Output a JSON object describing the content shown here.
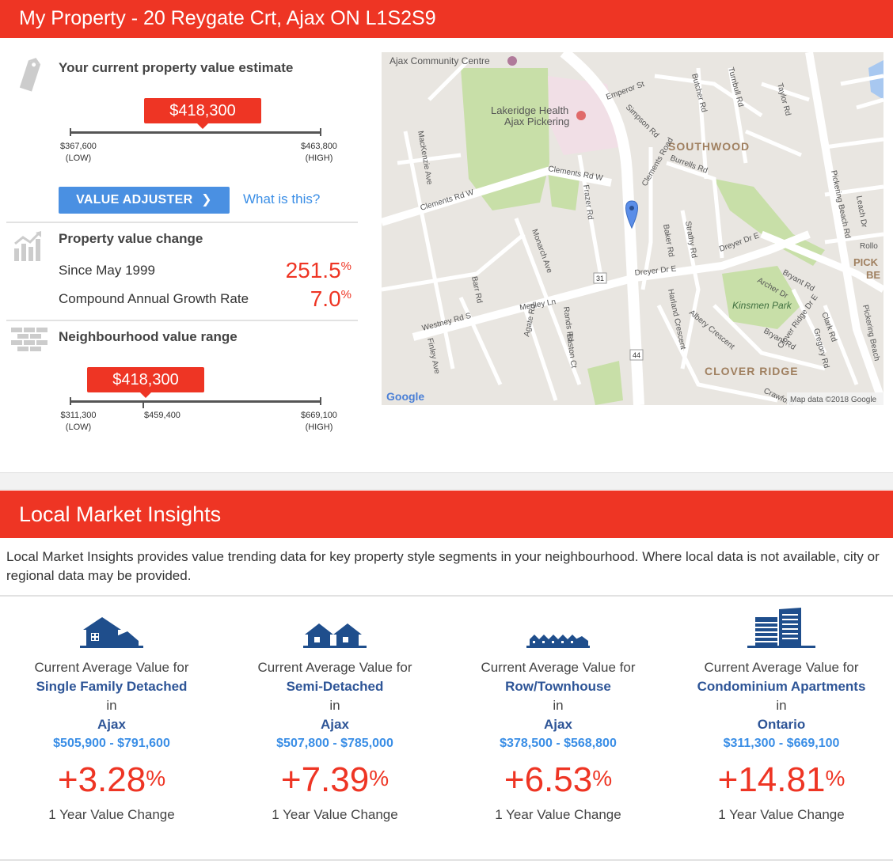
{
  "property": {
    "title": "My Property - 20 Reygate Crt, Ajax ON L1S2S9",
    "estimate": {
      "heading": "Your current property value estimate",
      "value": "$418,300",
      "low": "$367,600",
      "low_label": "(LOW)",
      "high": "$463,800",
      "high_label": "(HIGH)",
      "position_fraction": 0.532
    },
    "adjuster_button": "VALUE ADJUSTER",
    "what_link": "What is this?",
    "change": {
      "heading": "Property value change",
      "rows": [
        {
          "label": "Since May 1999",
          "value": "251.5",
          "unit": "%"
        },
        {
          "label": "Compound Annual Growth Rate",
          "value": "7.0",
          "unit": "%"
        }
      ]
    },
    "neighbourhood": {
      "heading": "Neighbourhood value range",
      "value": "$418,300",
      "low": "$311,300",
      "low_label": "(LOW)",
      "mid": "$459,400",
      "high": "$669,100",
      "high_label": "(HIGH)",
      "position_fraction": 0.3
    }
  },
  "map": {
    "labels": {
      "ajax_cc": "Ajax Community Centre",
      "lakeridge": "Lakeridge Health",
      "ajax_pickering": "Ajax Pickering",
      "southwood": "SOUTHWOOD",
      "clover_ridge": "CLOVER RIDGE",
      "kinsmen_park": "Kinsmen Park",
      "clements_rd_w": "Clements Rd W",
      "clements_rd_w2": "Clements Rd W",
      "westney": "Westney Rd S",
      "dreyer": "Dreyer Dr E",
      "dreyer2": "Dreyer Dr E",
      "emperor": "Emperor St",
      "simpson": "Simpson Rd",
      "butcher": "Butcher Rd",
      "turnbull": "Turnbull Rd",
      "taylor": "Taylor Rd",
      "pickering_beach": "Pickering Beach Rd",
      "pickering_beach2": "Pickering Beach",
      "mackenzie": "MacKenzie Ave",
      "monarch": "Monarch Ave",
      "fraser": "Frazer Rd",
      "baker": "Baker Rd",
      "strathy": "Strathy Rd",
      "bryant": "Bryant Rd",
      "bryant2": "Bryant Rd",
      "archer": "Archer Dr",
      "clark": "Clark Rd",
      "gregory": "Gregory Rd",
      "albery": "Albery Crescent",
      "harland": "Harland Crescent",
      "clover_ridge_dr": "Clover Ridge Dr E",
      "crawford": "Crawford",
      "barr": "Barr Rd",
      "finley": "Finley Ave",
      "agate": "Agate Rd",
      "easton": "Easton Ct",
      "rands": "Rands Rd",
      "medley": "Medley Ln",
      "burrells": "Burrells Rd",
      "clements_road": "Clements Road",
      "leach": "Leach Dr",
      "rollo": "Rollo",
      "pick": "PICK",
      "be": "BE",
      "route31": "31",
      "route44": "44",
      "google": "Google",
      "attribution": "Map data ©2018 Google"
    }
  },
  "insights": {
    "title": "Local Market Insights",
    "intro": "Local Market Insights provides value trending data for key property style segments in your neighbourhood. Where local data is not available, city or regional data may be provided.",
    "columns": [
      {
        "prefix": "Current Average Value for",
        "type": "Single Family Detached",
        "in": "in",
        "area": "Ajax",
        "range": "$505,900 - $791,600",
        "change": "+3.28",
        "unit": "%",
        "footer": "1 Year Value Change",
        "icon": "house-icon"
      },
      {
        "prefix": "Current Average Value for",
        "type": "Semi-Detached",
        "in": "in",
        "area": "Ajax",
        "range": "$507,800 - $785,000",
        "change": "+7.39",
        "unit": "%",
        "footer": "1 Year Value Change",
        "icon": "semi-detached-icon"
      },
      {
        "prefix": "Current Average Value for",
        "type": "Row/Townhouse",
        "in": "in",
        "area": "Ajax",
        "range": "$378,500 - $568,800",
        "change": "+6.53",
        "unit": "%",
        "footer": "1 Year Value Change",
        "icon": "townhouse-icon"
      },
      {
        "prefix": "Current Average Value for",
        "type": "Condominium Apartments",
        "in": "in",
        "area": "Ontario",
        "range": "$311,300 - $669,100",
        "change": "+14.81",
        "unit": "%",
        "footer": "1 Year Value Change",
        "icon": "condo-icon"
      }
    ]
  },
  "colors": {
    "accent": "#ee3524",
    "link": "#3a8ee6",
    "navy": "#2e5597",
    "button": "#4a90e2"
  }
}
